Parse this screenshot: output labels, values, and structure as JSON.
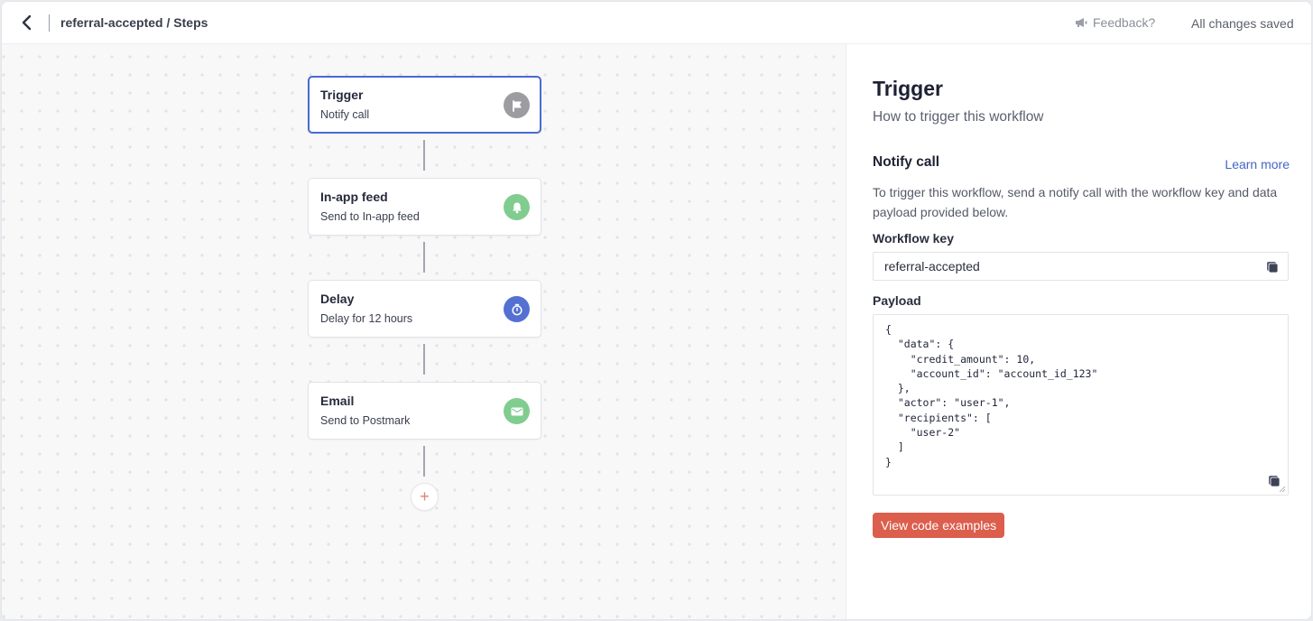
{
  "header": {
    "back_icon": "chevron-left-icon",
    "breadcrumb": "referral-accepted / Steps",
    "feedback_label": "Feedback?",
    "feedback_icon": "megaphone-icon",
    "save_status": "All changes saved"
  },
  "workflow": {
    "steps": [
      {
        "title": "Trigger",
        "subtitle": "Notify call",
        "icon": "flag-icon",
        "icon_color": "#9c9ca1",
        "selected": true
      },
      {
        "title": "In-app feed",
        "subtitle": "Send to In-app feed",
        "icon": "bell-icon",
        "icon_color": "#80cd8f",
        "selected": false
      },
      {
        "title": "Delay",
        "subtitle": "Delay for 12 hours",
        "icon": "timer-icon",
        "icon_color": "#5471d2",
        "selected": false
      },
      {
        "title": "Email",
        "subtitle": "Send to Postmark",
        "icon": "mail-icon",
        "icon_color": "#80cd8f",
        "selected": false
      }
    ],
    "add_step_label": "+"
  },
  "panel": {
    "title": "Trigger",
    "subtitle": "How to trigger this workflow",
    "section_title": "Notify call",
    "learn_more": "Learn more",
    "description": "To trigger this workflow, send a notify call with the workflow key and data payload provided below.",
    "workflow_key_label": "Workflow key",
    "workflow_key_value": "referral-accepted",
    "payload_label": "Payload",
    "payload_text": "{\n  \"data\": {\n    \"credit_amount\": 10,\n    \"account_id\": \"account_id_123\"\n  },\n  \"actor\": \"user-1\",\n  \"recipients\": [\n    \"user-2\"\n  ]\n}",
    "cta_label": "View code examples"
  },
  "colors": {
    "accent_blue": "#4a6ad2",
    "cta_red": "#dc5e4c",
    "link_blue": "#4664c8"
  }
}
